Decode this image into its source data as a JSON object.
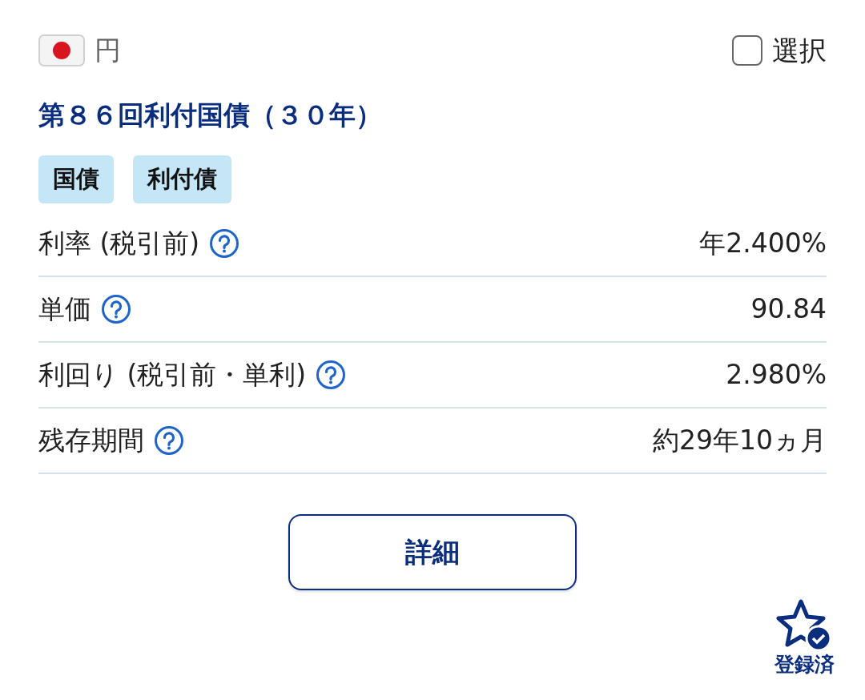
{
  "currency": {
    "label": "円"
  },
  "select": {
    "label": "選択",
    "checked": false
  },
  "title": "第８６回利付国債（３０年）",
  "tags": [
    "国債",
    "利付債"
  ],
  "rows": [
    {
      "label": "利率 (税引前)",
      "value": "年2.400%"
    },
    {
      "label": "単価",
      "value": "90.84"
    },
    {
      "label": "利回り (税引前・単利)",
      "value": "2.980%"
    },
    {
      "label": "残存期間",
      "value": "約29年10ヵ月"
    }
  ],
  "detail_button": "詳細",
  "favorite": {
    "label": "登録済",
    "registered": true
  }
}
